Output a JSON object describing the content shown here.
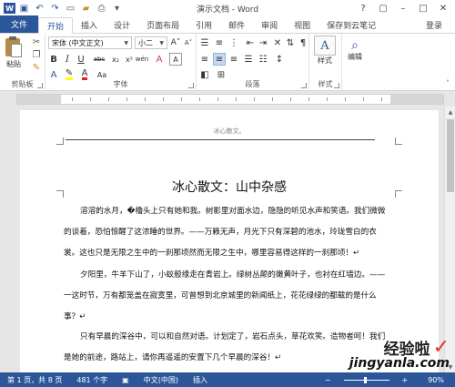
{
  "window": {
    "title": "演示文档 - Word",
    "controls": [
      "?",
      "▢",
      "–",
      "□",
      "✕"
    ]
  },
  "ribbon_tabs": [
    "文件",
    "开始",
    "插入",
    "设计",
    "页面布局",
    "引用",
    "邮件",
    "审阅",
    "视图",
    "保存到云笔记",
    "登录"
  ],
  "clipboard": {
    "paste_label": "粘贴",
    "group_label": "剪贴板"
  },
  "font": {
    "name": "宋体 (中文正文)",
    "size": "小二",
    "group_label": "字体",
    "btn_b": "B",
    "btn_i": "I",
    "btn_u": "U",
    "btn_abc": "abc",
    "btn_x2": "x₂",
    "btn_xsup": "x²",
    "btn_a_color": "A",
    "btn_aa": "Aa",
    "btn_grow": "A",
    "btn_shrink": "A",
    "btn_wen": "wén",
    "btn_clear": "A"
  },
  "paragraph": {
    "group_label": "段落"
  },
  "styles": {
    "style_label": "样式",
    "group_label": "样式",
    "edit_label": "编辑",
    "style_glyph": "A"
  },
  "document": {
    "header": "冰心散文。",
    "title": "冰心散文：山中杂感",
    "paragraphs": [
      [
        "溶溶的水月，�櫓头上只有她和我。树影里对面水边，隐隐的听见水声和笑语。我们微微",
        "的谈着，恐怕惊醒了这浓睡的世界。——万籁无声，月光下只有深碧的池水，玲珑雪白的衣",
        "裳。这也只是无限之生中的一刹那顷然而无限之生中，哪里容易得这样的一刹那顷！↵"
      ],
      [
        "夕阳里，牛羊下山了，小蚁般缘走在青岩上。绿树丛颠的嫩黄叶子，也衬在红墙边。——",
        "一这时节，万有都笼盖在寂寞里，可曾想到北京城里的新闻纸上，花花绿绿的都载的是什么",
        "事？↵"
      ],
      [
        "只有早晨的深谷中，可以和自然对语。计划定了，岩石点头，草花欢笑。造物者呵！我们",
        "是她的前途，路站上，请你再遥遥的安置下几个早晨的深谷！↵"
      ]
    ]
  },
  "status": {
    "page": "第 1 页，共 8 页",
    "words": "481 个字",
    "lang": "中文(中国)",
    "mode": "插入",
    "zoom": "90%"
  },
  "watermark": {
    "line1": "经验啦",
    "check": "✓",
    "line2": "jingyanla.com"
  }
}
